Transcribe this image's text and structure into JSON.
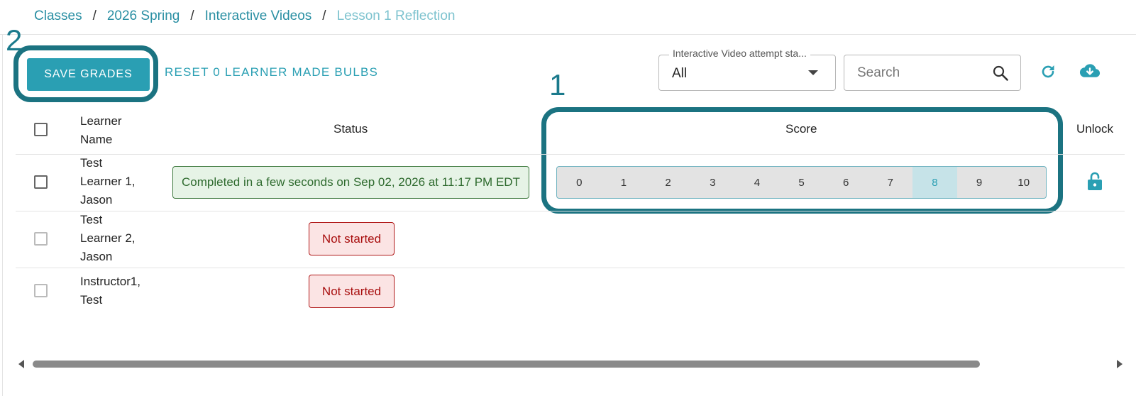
{
  "breadcrumb": [
    {
      "label": "Classes"
    },
    {
      "label": "2026 Spring"
    },
    {
      "label": "Interactive Videos"
    },
    {
      "label": "Lesson 1 Reflection"
    }
  ],
  "breadcrumb_separator": "/",
  "callouts": {
    "one": "1",
    "two": "2"
  },
  "toolbar": {
    "save_label": "SAVE GRADES",
    "reset_label": "RESET 0 LEARNER MADE BULBS",
    "filter_label": "Interactive Video attempt sta...",
    "filter_value": "All",
    "search_placeholder": "Search",
    "icons": {
      "search": "search-icon",
      "refresh": "refresh-icon",
      "download": "cloud-download-icon"
    }
  },
  "table": {
    "headers": {
      "name_line1": "Learner",
      "name_line2": "Name",
      "status": "Status",
      "score": "Score",
      "unlock": "Unlock"
    },
    "rows": [
      {
        "name_lines": [
          "Test",
          "Learner 1,",
          "Jason"
        ],
        "status": "Completed in a few seconds on Sep 02, 2026 at 11:17 PM EDT",
        "status_type": "completed",
        "score_options": [
          "0",
          "1",
          "2",
          "3",
          "4",
          "5",
          "6",
          "7",
          "8",
          "9",
          "10"
        ],
        "selected_score": "8",
        "unlock_icon": "lock-icon"
      },
      {
        "name_lines": [
          "Test",
          "Learner 2,",
          "Jason"
        ],
        "status": "Not started",
        "status_type": "not-started"
      },
      {
        "name_lines": [
          "Instructor1,",
          "Test"
        ],
        "status": "Not started",
        "status_type": "not-started"
      }
    ]
  },
  "colors": {
    "accent": "#2a9fb3",
    "callout": "#1b7381",
    "completed_bg": "#e6f3e6",
    "not_started_bg": "#fbe4e4",
    "selected_score_bg": "#c6e3e8"
  }
}
